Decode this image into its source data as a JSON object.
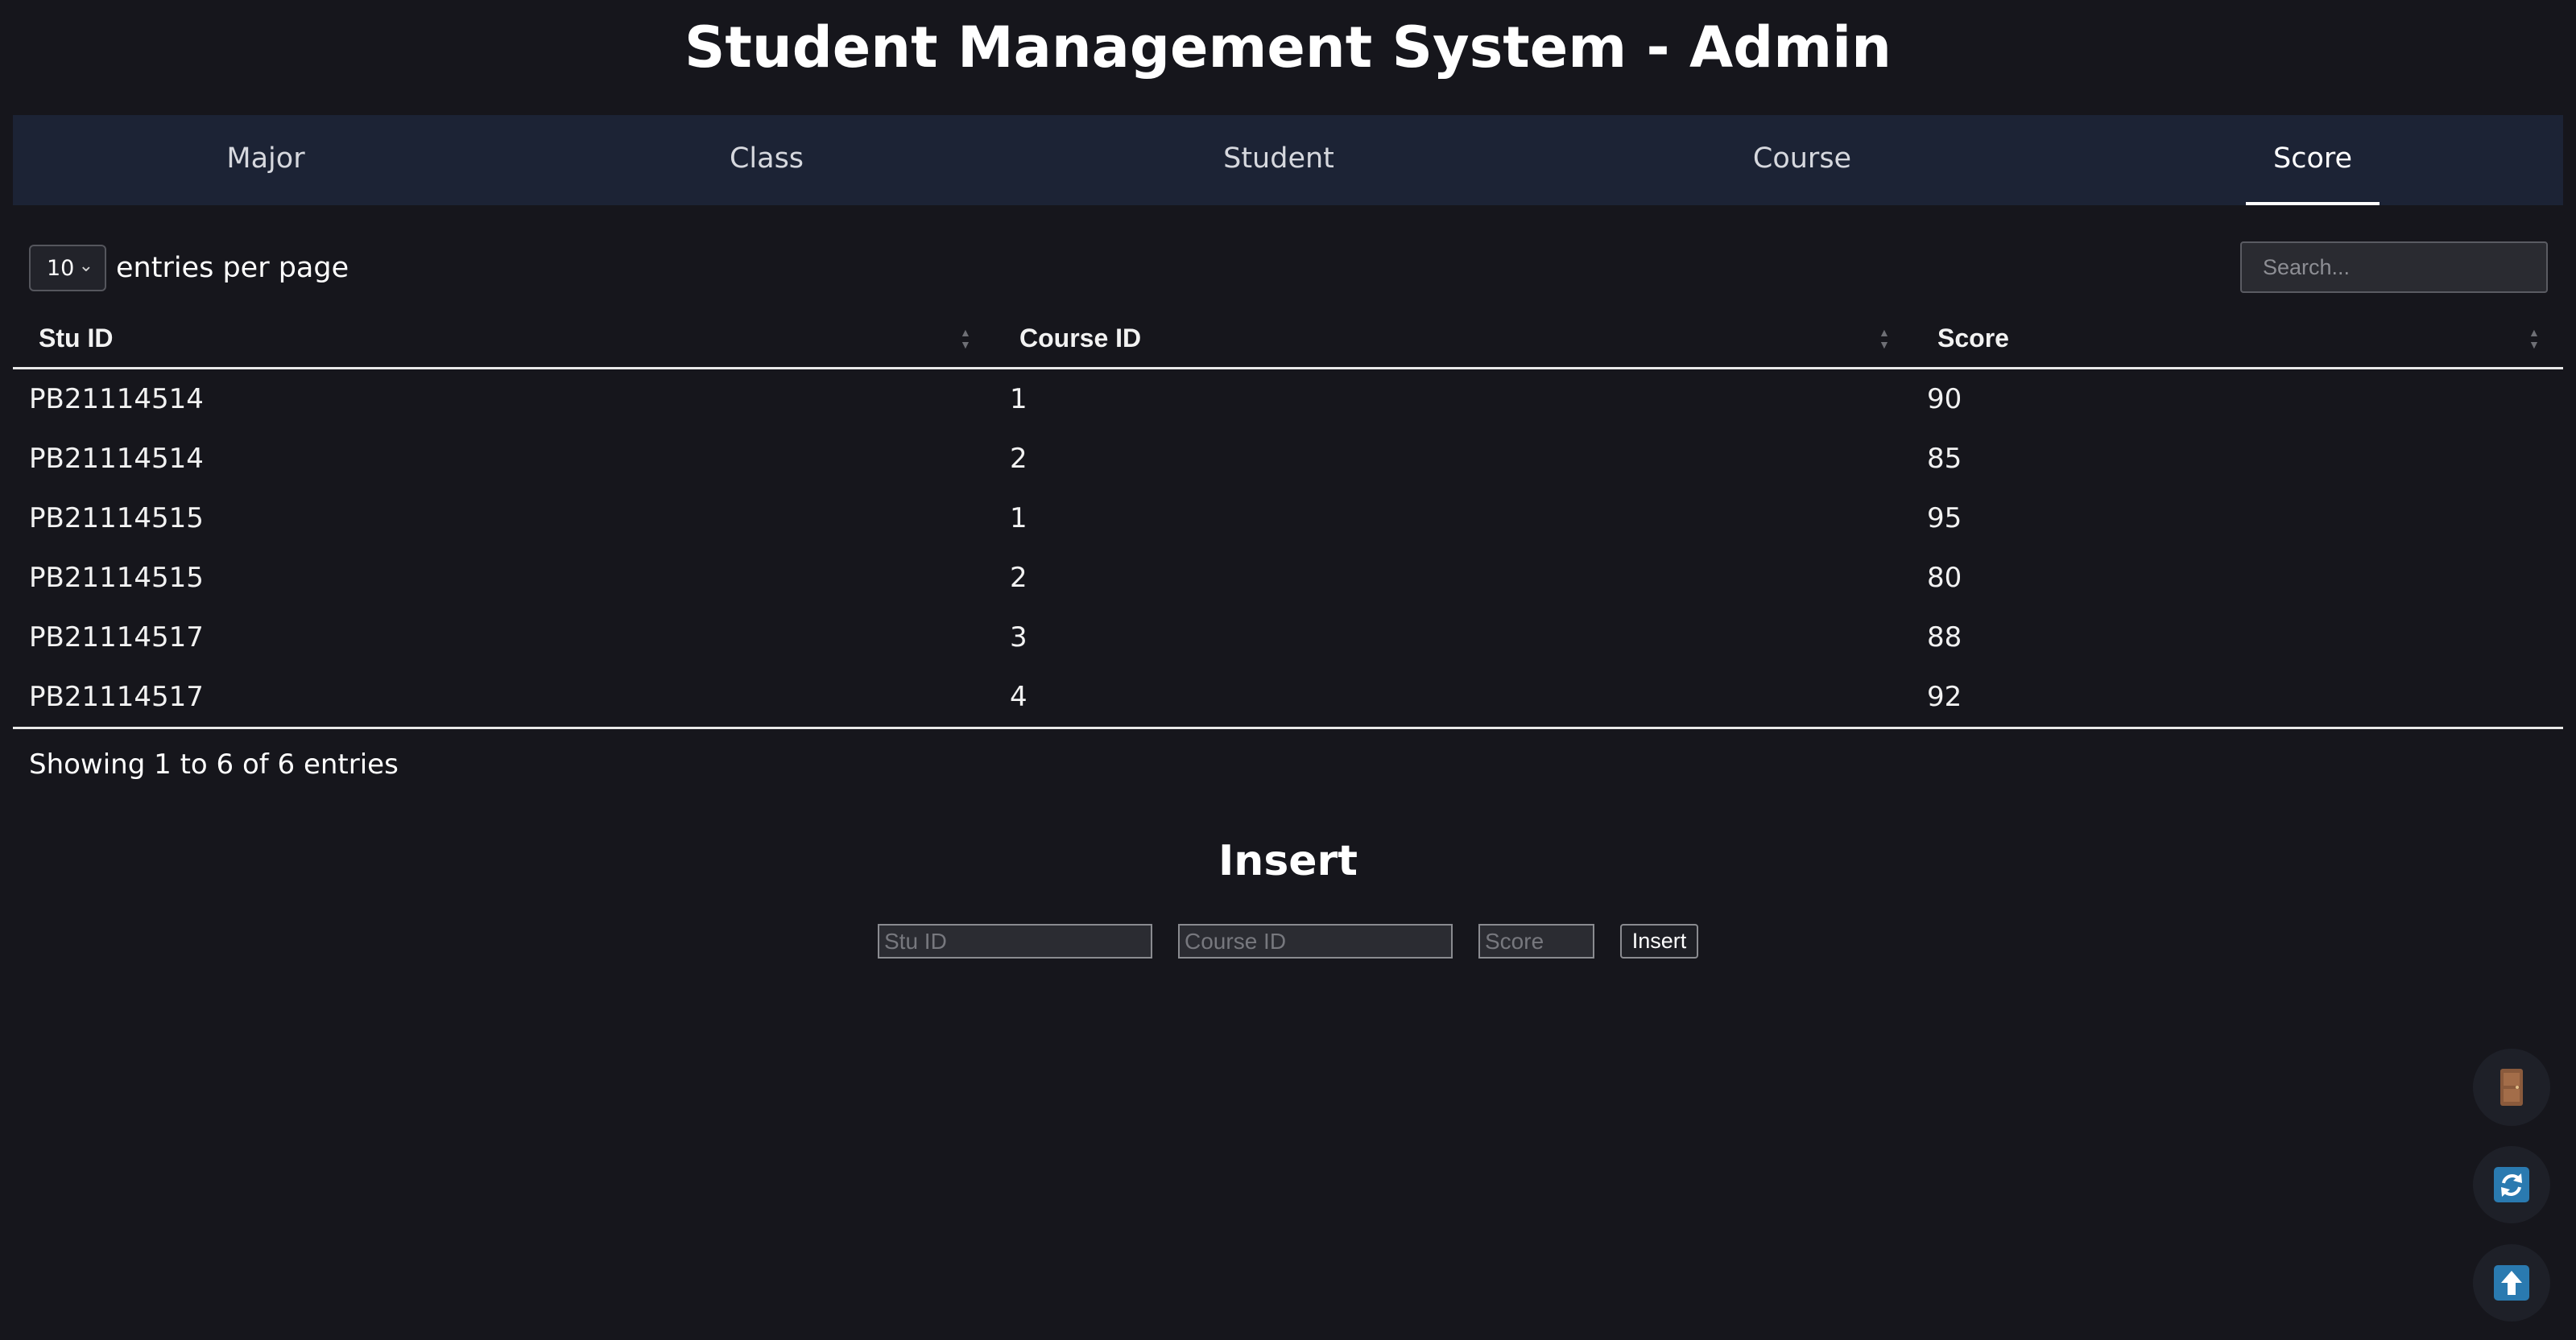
{
  "app": {
    "title": "Student Management System - Admin"
  },
  "nav": {
    "tabs": [
      {
        "label": "Major",
        "active": false
      },
      {
        "label": "Class",
        "active": false
      },
      {
        "label": "Student",
        "active": false
      },
      {
        "label": "Course",
        "active": false
      },
      {
        "label": "Score",
        "active": true
      }
    ]
  },
  "table_controls": {
    "page_size": "10",
    "entries_label": "entries per page",
    "search_placeholder": "Search..."
  },
  "table": {
    "columns": [
      "Stu ID",
      "Course ID",
      "Score"
    ],
    "rows": [
      [
        "PB21114514",
        "1",
        "90"
      ],
      [
        "PB21114514",
        "2",
        "85"
      ],
      [
        "PB21114515",
        "1",
        "95"
      ],
      [
        "PB21114515",
        "2",
        "80"
      ],
      [
        "PB21114517",
        "3",
        "88"
      ],
      [
        "PB21114517",
        "4",
        "92"
      ]
    ],
    "info": "Showing 1 to 6 of 6 entries"
  },
  "insert_form": {
    "title": "Insert",
    "stu_id_placeholder": "Stu ID",
    "course_id_placeholder": "Course ID",
    "score_placeholder": "Score",
    "button_label": "Insert"
  },
  "floating_actions": [
    {
      "icon": "door-icon",
      "color": "#8a5a3c"
    },
    {
      "icon": "refresh-icon",
      "color": "#2a7ab0"
    },
    {
      "icon": "arrow-up-icon",
      "color": "#2a7ab0"
    }
  ]
}
